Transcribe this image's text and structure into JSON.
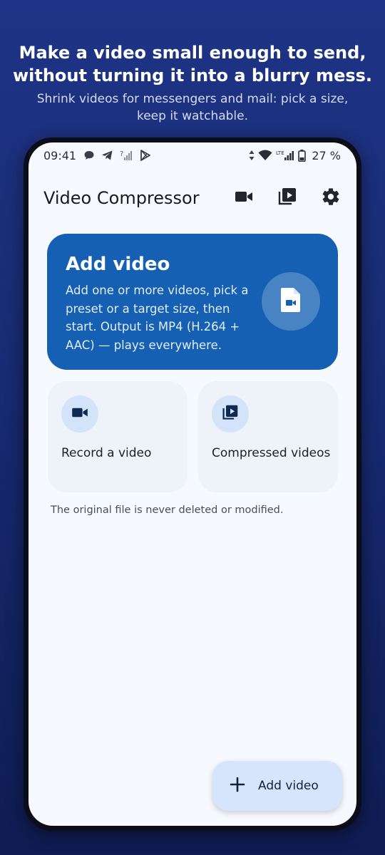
{
  "promo": {
    "title_line1": "Make a video small enough to send,",
    "title_line2": "without turning it into a blurry mess.",
    "subtitle_line1": "Shrink videos for messengers and mail: pick a size,",
    "subtitle_line2": "keep it watchable."
  },
  "status_bar": {
    "time": "09:41",
    "left_icons": [
      "chat-bubble-icon",
      "telegram-icon",
      "signal-unknown-icon",
      "play-store-icon"
    ],
    "right_icons": [
      "data-arrows-icon",
      "wifi-icon",
      "lte-signal-icon",
      "battery-icon"
    ],
    "battery": "27 %"
  },
  "app_bar": {
    "title": "Video Compressor",
    "actions": [
      "videocam-icon",
      "video-library-icon",
      "settings-icon"
    ]
  },
  "hero": {
    "title": "Add video",
    "body": "Add one or more videos, pick a preset or a target size, then start. Output is MP4 (H.264 + AAC) — plays everywhere.",
    "icon": "video-file-icon",
    "color": "#1560b3"
  },
  "tiles": [
    {
      "label": "Record a video",
      "icon": "videocam-icon"
    },
    {
      "label": "Compressed videos",
      "icon": "video-library-icon"
    }
  ],
  "note": "The original file is never deleted or modified.",
  "fab": {
    "label": "Add video",
    "icon": "plus-icon"
  },
  "colors": {
    "background_top": "#1e3486",
    "background_bottom": "#0f1c52",
    "accent": "#1560b3",
    "tile": "#eef2f9",
    "fab": "#d6e5fb"
  }
}
